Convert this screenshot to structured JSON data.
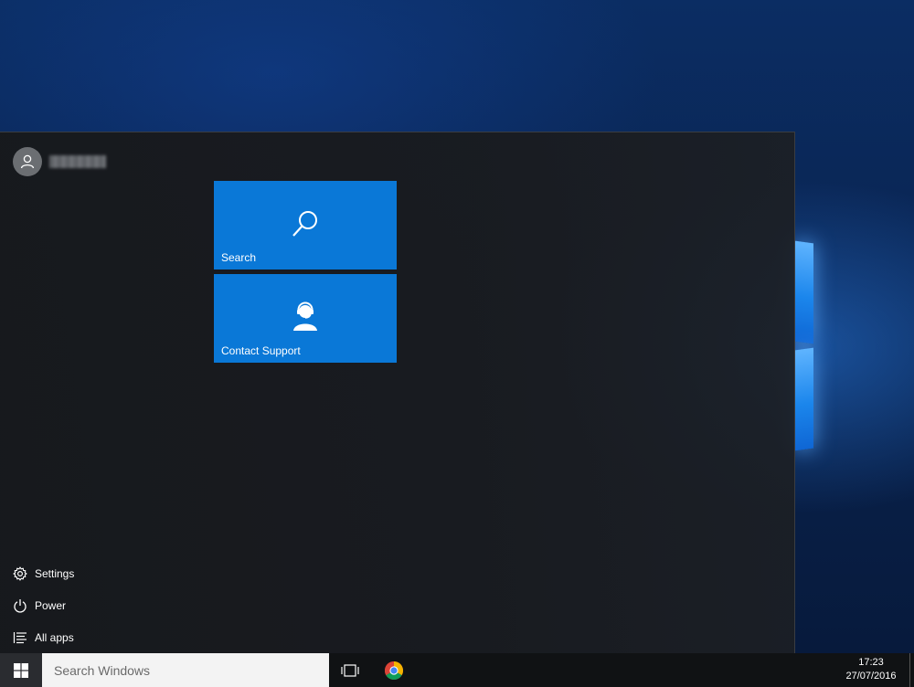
{
  "start_menu": {
    "user": {
      "avatar_icon": "user-icon",
      "name": ""
    },
    "tiles": [
      {
        "label": "Search",
        "icon": "magnifier-icon",
        "color": "#0a78d7"
      },
      {
        "label": "Contact Support",
        "icon": "support-agent-icon",
        "color": "#0a78d7"
      }
    ],
    "links": [
      {
        "label": "Settings",
        "icon": "gear-icon"
      },
      {
        "label": "Power",
        "icon": "power-icon"
      },
      {
        "label": "All apps",
        "icon": "list-icon"
      }
    ]
  },
  "taskbar": {
    "start_icon": "windows-logo-icon",
    "search_placeholder": "Search Windows",
    "task_view_icon": "task-view-icon",
    "pinned_app_icon": "chrome-icon",
    "clock": {
      "time": "17:23",
      "date": "27/07/2016"
    }
  },
  "colors": {
    "accent": "#0a78d7",
    "start_menu_bg": "#1a1c1f",
    "taskbar_bg": "#101214"
  }
}
